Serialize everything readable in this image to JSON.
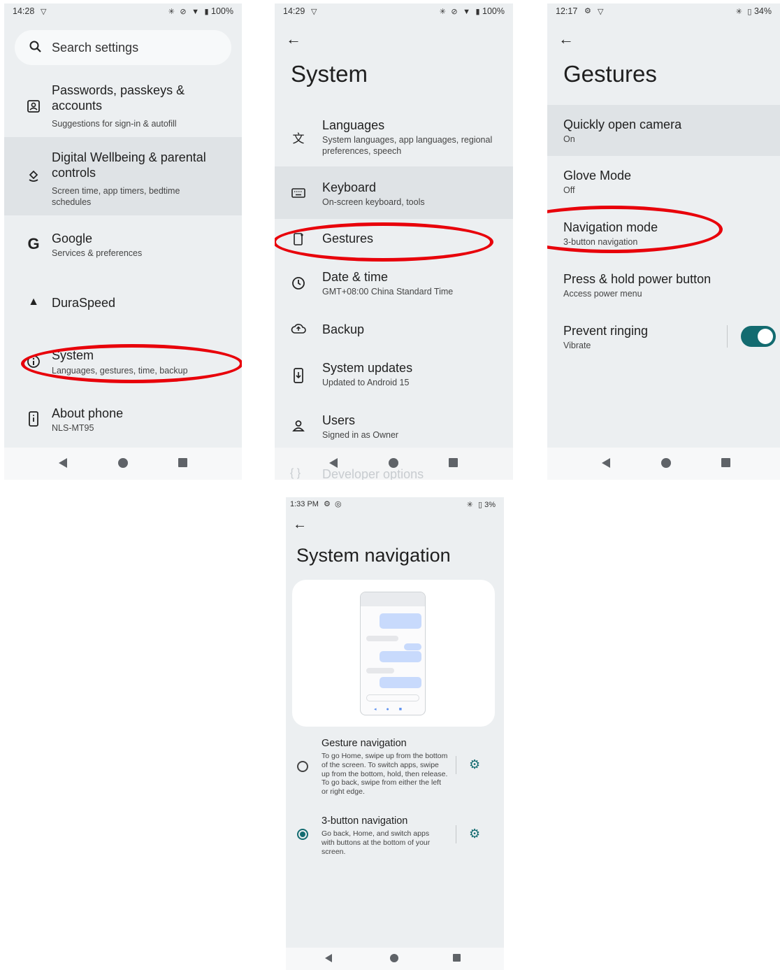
{
  "screen1": {
    "status": {
      "time": "14:28",
      "battery": "100%"
    },
    "search_placeholder": "Search settings",
    "items": [
      {
        "title": "Passwords, passkeys & accounts",
        "subtitle": "Suggestions for sign-in & autofill",
        "icon": "account-box-icon"
      },
      {
        "title": "Digital Wellbeing & parental controls",
        "subtitle": "Screen time, app timers, bedtime schedules",
        "icon": "wellbeing-icon"
      },
      {
        "title": "Google",
        "subtitle": "Services & preferences",
        "icon": "google-icon"
      },
      {
        "title": "DuraSpeed",
        "subtitle": "",
        "icon": "rocket-icon"
      },
      {
        "title": "System",
        "subtitle": "Languages, gestures, time, backup",
        "icon": "info-icon"
      },
      {
        "title": "About phone",
        "subtitle": "NLS-MT95",
        "icon": "phone-info-icon"
      }
    ]
  },
  "screen2": {
    "status": {
      "time": "14:29",
      "battery": "100%"
    },
    "title": "System",
    "items": [
      {
        "title": "Languages",
        "subtitle": "System languages, app languages, regional preferences, speech",
        "icon": "translate-icon"
      },
      {
        "title": "Keyboard",
        "subtitle": "On-screen keyboard, tools",
        "icon": "keyboard-icon"
      },
      {
        "title": "Gestures",
        "subtitle": "",
        "icon": "gestures-icon"
      },
      {
        "title": "Date & time",
        "subtitle": "GMT+08:00 China Standard Time",
        "icon": "clock-icon"
      },
      {
        "title": "Backup",
        "subtitle": "",
        "icon": "cloud-backup-icon"
      },
      {
        "title": "System updates",
        "subtitle": "Updated to Android 15",
        "icon": "system-update-icon"
      },
      {
        "title": "Users",
        "subtitle": "Signed in as Owner",
        "icon": "user-icon"
      },
      {
        "title": "Developer options",
        "subtitle": "",
        "icon": "code-braces-icon"
      }
    ]
  },
  "screen3": {
    "status": {
      "time": "12:17",
      "battery": "34%"
    },
    "title": "Gestures",
    "items": [
      {
        "title": "Quickly open camera",
        "subtitle": "On"
      },
      {
        "title": "Glove Mode",
        "subtitle": "Off"
      },
      {
        "title": "Navigation mode",
        "subtitle": "3-button navigation"
      },
      {
        "title": "Press & hold power button",
        "subtitle": "Access power menu"
      },
      {
        "title": "Prevent ringing",
        "subtitle": "Vibrate",
        "toggle_on": true
      }
    ]
  },
  "screen4": {
    "status": {
      "time": "1:33 PM",
      "battery": "3%"
    },
    "title": "System navigation",
    "options": [
      {
        "title": "Gesture navigation",
        "description": "To go Home, swipe up from the bottom of the screen. To switch apps, swipe up from the bottom, hold, then release. To go back, swipe from either the left or right edge.",
        "selected": false
      },
      {
        "title": "3-button navigation",
        "description": "Go back, Home, and switch apps with buttons at the bottom of your screen.",
        "selected": true
      }
    ]
  },
  "colors": {
    "accent": "#136b70",
    "annotation": "#e8000a",
    "background": "#eceff1",
    "highlight": "#dfe3e6"
  }
}
